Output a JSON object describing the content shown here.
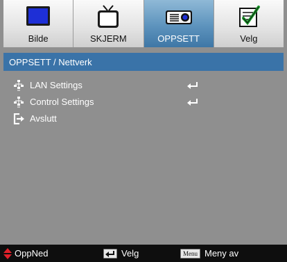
{
  "tabs": [
    {
      "label": "Bilde",
      "icon": "monitor-icon",
      "active": false
    },
    {
      "label": "SKJERM",
      "icon": "tv-icon",
      "active": false
    },
    {
      "label": "OPPSETT",
      "icon": "projector-icon",
      "active": true
    },
    {
      "label": "Velg",
      "icon": "notepad-check-icon",
      "active": false
    }
  ],
  "breadcrumb": "OPPSETT / Nettverk",
  "menu": [
    {
      "label": "LAN Settings",
      "icon": "network-icon",
      "has_enter": true
    },
    {
      "label": "Control Settings",
      "icon": "network-icon",
      "has_enter": true
    },
    {
      "label": "Avslutt",
      "icon": "exit-icon",
      "has_enter": false
    }
  ],
  "footer": {
    "nav_label": "OppNed",
    "select_label": "Velg",
    "menu_key": "Menu",
    "menu_label": "Meny av"
  },
  "colors": {
    "accent": "#3a73a8",
    "background": "#8f8f8f",
    "nav_arrow": "#e0202a"
  }
}
